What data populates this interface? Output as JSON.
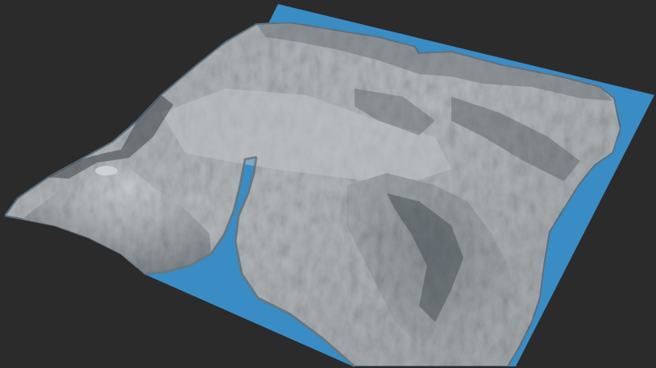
{
  "colors": {
    "background": "#2b2b2b",
    "water": "#3a8cc4",
    "water_edge": "#4a7e9c",
    "terrain_light": "#b9bdc0",
    "terrain_mid": "#8e9397",
    "terrain_dark": "#4f565c",
    "ridge_shadow": "#3c4449"
  },
  "scene": {
    "type": "3d-terrain-heightmap-render",
    "features": [
      "ocean-plane",
      "island-terrain",
      "volcano-cone",
      "inlet-channel",
      "mountain-ridges"
    ]
  }
}
